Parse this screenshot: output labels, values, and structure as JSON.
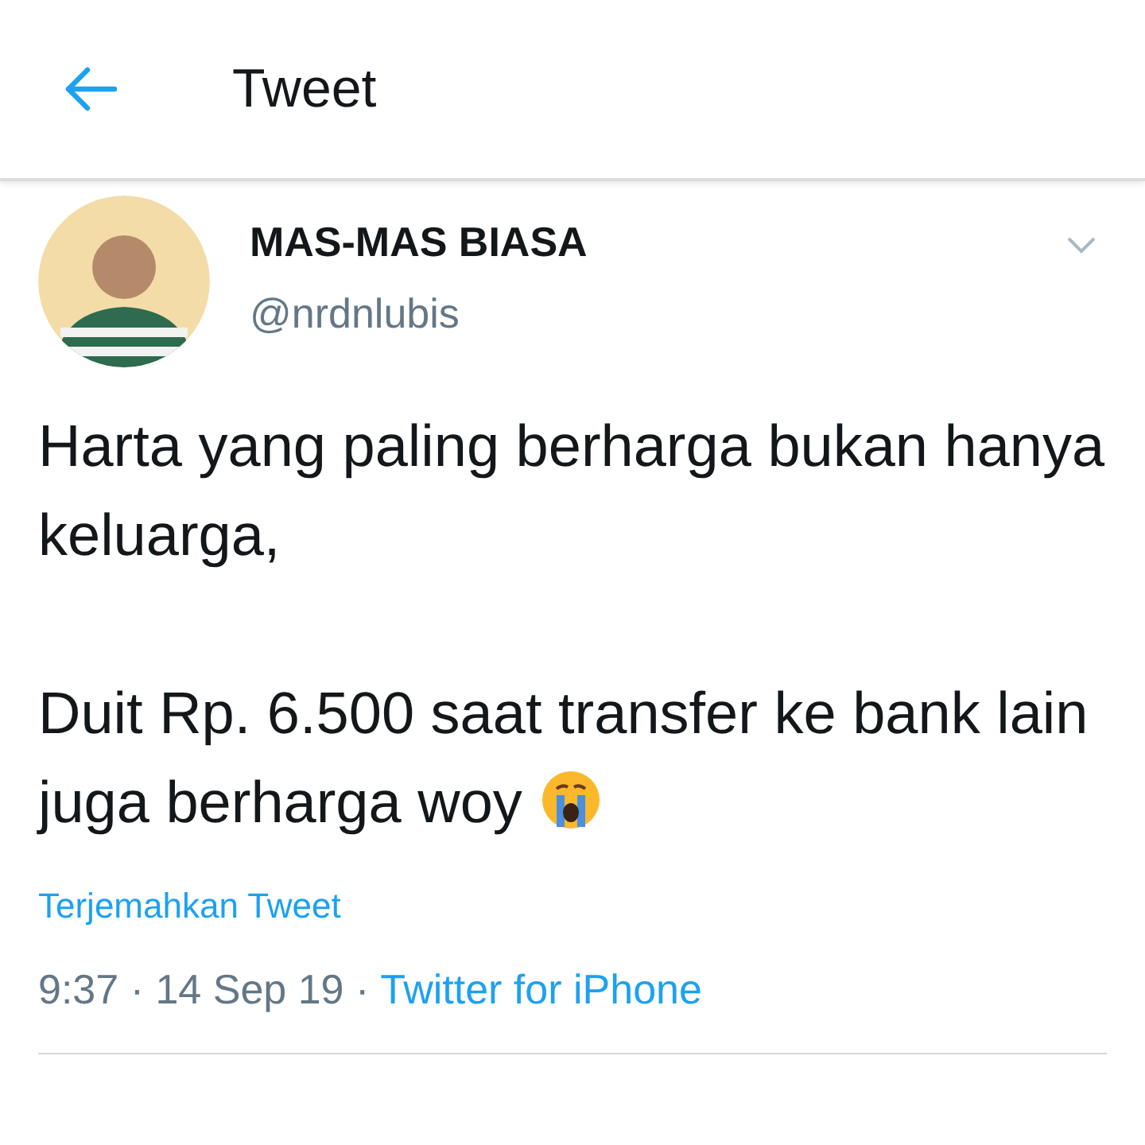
{
  "header": {
    "title": "Tweet"
  },
  "tweet": {
    "name": "MAS-MAS BIASA",
    "handle": "@nrdnlubis",
    "paragraphs": [
      "Harta yang paling berharga bukan hanya keluarga,",
      "Duit Rp. 6.500 saat transfer ke bank lain juga berharga woy"
    ],
    "translate_link": "Terjemahkan Tweet",
    "time": "9:37 · 14 Sep 19 ·",
    "source": "Twitter for iPhone"
  }
}
